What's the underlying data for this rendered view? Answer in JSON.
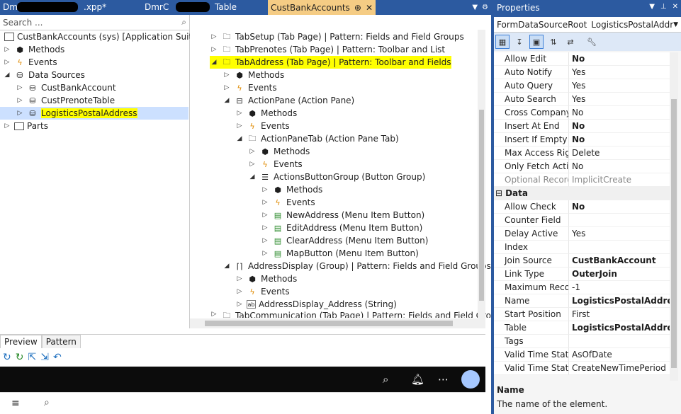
{
  "tabs": [
    {
      "label": "Dm",
      "suffix": ".xpp*"
    },
    {
      "label": "DmrC",
      "suffix": "Table"
    },
    {
      "label": "CustBankAccounts",
      "pin": "⊕",
      "close": "✕"
    }
  ],
  "left_tree": {
    "search_placeholder": "Search ...",
    "rows": [
      {
        "label": "CustBankAccounts (sys) [Application Suite]"
      },
      {
        "label": "Methods"
      },
      {
        "label": "Events"
      },
      {
        "label": "Data Sources"
      },
      {
        "label": "CustBankAccount"
      },
      {
        "label": "CustPrenoteTable"
      },
      {
        "label": "LogisticsPostalAddress"
      },
      {
        "label": "Parts"
      }
    ]
  },
  "mid_tree": {
    "rows": [
      {
        "label": "TabSetup (Tab Page) | Pattern: Fields and Field Groups"
      },
      {
        "label": "TabPrenotes (Tab Page) | Pattern: Toolbar and List"
      },
      {
        "label": "TabAddress (Tab Page) | Pattern: Toolbar and Fields"
      },
      {
        "label": "Methods"
      },
      {
        "label": "Events"
      },
      {
        "label": "ActionPane (Action Pane)"
      },
      {
        "label": "Methods"
      },
      {
        "label": "Events"
      },
      {
        "label": "ActionPaneTab (Action Pane Tab)"
      },
      {
        "label": "Methods"
      },
      {
        "label": "Events"
      },
      {
        "label": "ActionsButtonGroup (Button Group)"
      },
      {
        "label": "Methods"
      },
      {
        "label": "Events"
      },
      {
        "label": "NewAddress (Menu Item Button)"
      },
      {
        "label": "EditAddress (Menu Item Button)"
      },
      {
        "label": "ClearAddress (Menu Item Button)"
      },
      {
        "label": "MapButton (Menu Item Button)"
      },
      {
        "label": "AddressDisplay (Group) | Pattern: Fields and Field Groups"
      },
      {
        "label": "Methods"
      },
      {
        "label": "Events"
      },
      {
        "label": "AddressDisplay_Address (String)"
      },
      {
        "label": "TabCommunication (Tab Page) | Pattern: Fields and Field Grou"
      }
    ]
  },
  "bottom_tabs": [
    "Preview",
    "Pattern"
  ],
  "properties": {
    "title": "Properties",
    "selected_type": "FormDataSourceRoot",
    "selected_name": "LogisticsPostalAddress",
    "rows": [
      {
        "name": "Allow Edit",
        "value": "No"
      },
      {
        "name": "Auto Notify",
        "value": "Yes"
      },
      {
        "name": "Auto Query",
        "value": "Yes"
      },
      {
        "name": "Auto Search",
        "value": "Yes"
      },
      {
        "name": "Cross Company Aut",
        "value": "No"
      },
      {
        "name": "Insert At End",
        "value": "No"
      },
      {
        "name": "Insert If Empty",
        "value": "No"
      },
      {
        "name": "Max Access Right",
        "value": "Delete"
      },
      {
        "name": "Only Fetch Active",
        "value": "No"
      },
      {
        "name": "Optional Record Mc",
        "value": "ImplicitCreate"
      },
      {
        "category": "Data"
      },
      {
        "name": "Allow Check",
        "value": "No"
      },
      {
        "name": "Counter Field",
        "value": ""
      },
      {
        "name": "Delay Active",
        "value": "Yes"
      },
      {
        "name": "Index",
        "value": ""
      },
      {
        "name": "Join Source",
        "value": "CustBankAccount"
      },
      {
        "name": "Link Type",
        "value": "OuterJoin"
      },
      {
        "name": "Maximum Records",
        "value": "-1"
      },
      {
        "name": "Name",
        "value": "LogisticsPostalAddres"
      },
      {
        "name": "Start Position",
        "value": "First"
      },
      {
        "name": "Table",
        "value": "LogisticsPostalAddres"
      },
      {
        "name": "Tags",
        "value": ""
      },
      {
        "name": "Valid Time State Aut",
        "value": "AsOfDate"
      },
      {
        "name": "Valid Time State Up",
        "value": "CreateNewTimePeriod"
      }
    ],
    "desc_title": "Name",
    "desc_text": "The name of the element."
  }
}
